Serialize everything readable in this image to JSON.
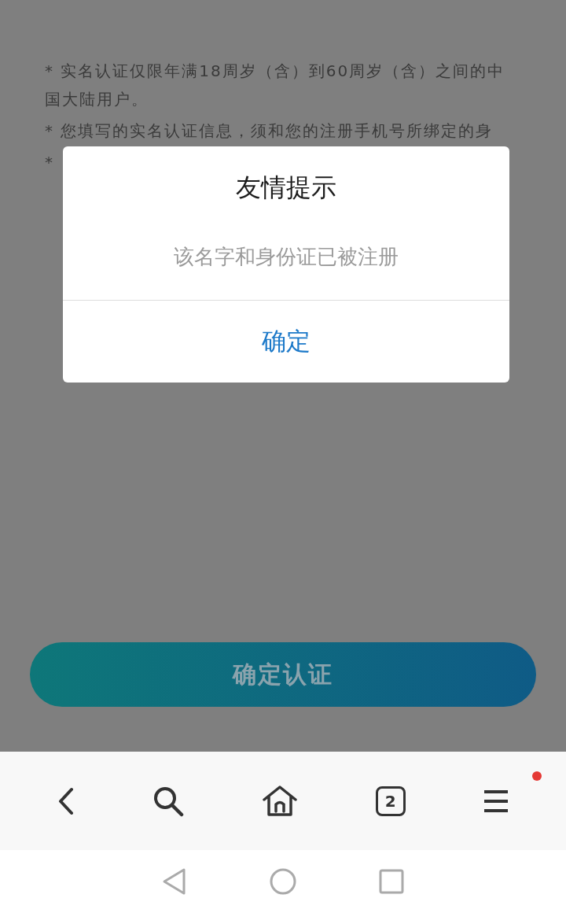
{
  "notes": [
    "* 实名认证仅限年满18周岁（含）到60周岁（含）之间的中国大陆用户。",
    "* 您填写的实名认证信息，须和您的注册手机号所绑定的身",
    "*"
  ],
  "submit_button": {
    "label": "确定认证"
  },
  "dialog": {
    "title": "友情提示",
    "message": "该名字和身份证已被注册",
    "buttons": [
      "确定"
    ]
  },
  "toolbar": {
    "tab_count": "2",
    "menu_notification": true
  }
}
